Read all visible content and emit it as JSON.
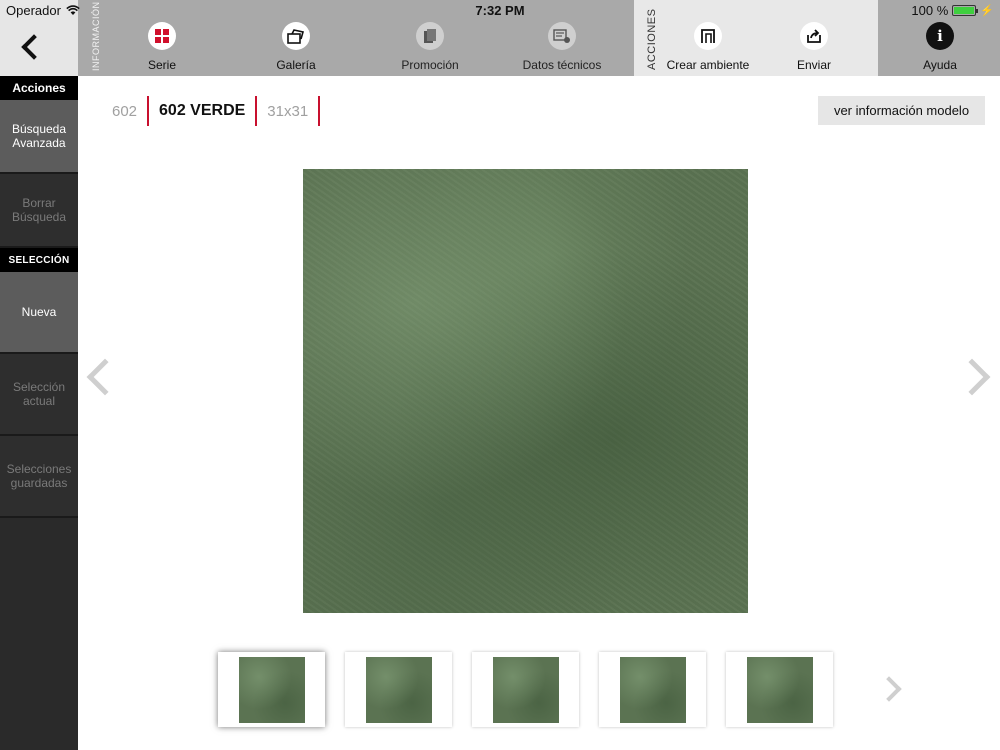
{
  "status": {
    "carrier": "Operador",
    "time": "7:32 PM",
    "battery": "100 %",
    "battery_level": 1.0
  },
  "toolbar": {
    "info_group_label": "INFORMACIÓN",
    "actions_group_label": "ACCIONES",
    "serie_label": "Serie",
    "galeria_label": "Galería",
    "promocion_label": "Promoción",
    "datos_label": "Datos técnicos",
    "crear_label": "Crear ambiente",
    "enviar_label": "Enviar",
    "ayuda_label": "Ayuda",
    "ayuda_icon_glyph": "i",
    "accent": "#d0102c"
  },
  "sidebar": {
    "acciones_header": "Acciones",
    "busqueda_label": "Búsqueda Avanzada",
    "borrar_label": "Borrar Búsqueda",
    "seleccion_header": "SELECCIÓN",
    "nueva_label": "Nueva",
    "actual_label": "Selección actual",
    "guardadas_label": "Selecciones guardadas"
  },
  "breadcrumb": {
    "series": "602",
    "product": "602 VERDE",
    "size": "31x31"
  },
  "main": {
    "info_button": "ver información modelo",
    "tile_color": "#5b7352"
  },
  "thumbnails": {
    "count": 5,
    "selected_index": 0
  }
}
